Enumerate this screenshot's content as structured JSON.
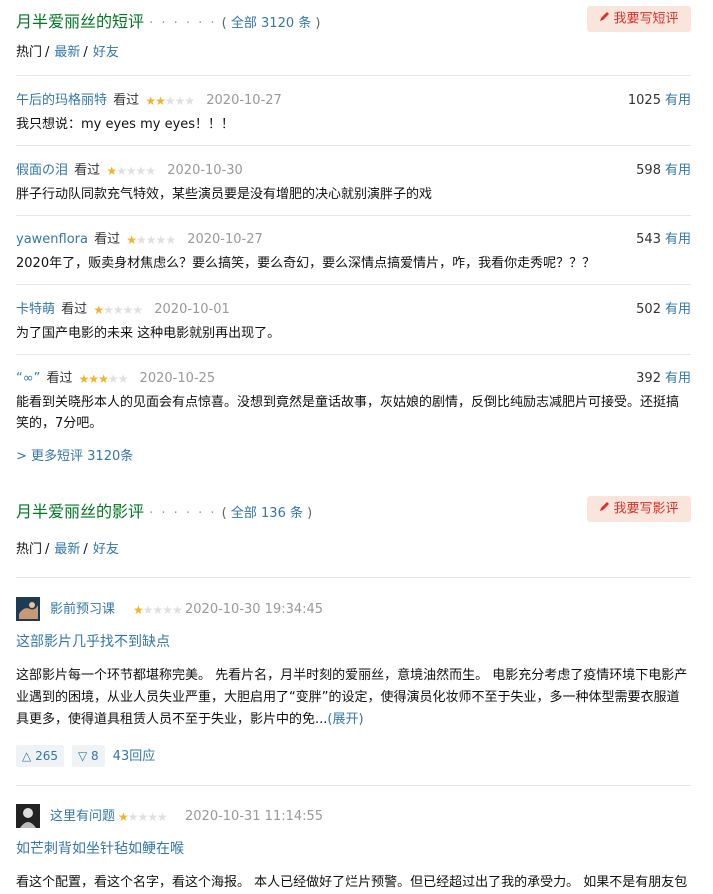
{
  "short_comments": {
    "title": "月半爱丽丝的短评",
    "dots": "· · · · · ·",
    "count_label": "全部 3120 条",
    "write_button": "我要写短评",
    "tabs": [
      "热门",
      "最新",
      "好友"
    ],
    "items": [
      {
        "user": "午后的玛格丽特",
        "status": "看过",
        "rating": 2,
        "date": "2020-10-27",
        "votes": "1025",
        "useful": "有用",
        "text": "我只想说：my eyes my eyes！！！"
      },
      {
        "user": "假面の泪",
        "status": "看过",
        "rating": 1,
        "date": "2020-10-30",
        "votes": "598",
        "useful": "有用",
        "text": "胖子行动队同款充气特效，某些演员要是没有增肥的决心就别演胖子的戏"
      },
      {
        "user": "yawenflora",
        "status": "看过",
        "rating": 1,
        "date": "2020-10-27",
        "votes": "543",
        "useful": "有用",
        "text": "2020年了，贩卖身材焦虑么？要么搞笑，要么奇幻，要么深情点搞爱情片，咋，我看你走秀呢？？？"
      },
      {
        "user": "卡特萌",
        "status": "看过",
        "rating": 1,
        "date": "2020-10-01",
        "votes": "502",
        "useful": "有用",
        "text": "为了国产电影的未来 这种电影就别再出现了。"
      },
      {
        "user": "“∞”",
        "status": "看过",
        "rating": 3,
        "date": "2020-10-25",
        "votes": "392",
        "useful": "有用",
        "text": "能看到关晓彤本人的见面会有点惊喜。没想到竟然是童话故事，灰姑娘的剧情，反倒比纯励志减肥片可接受。还挺搞笑的，7分吧。"
      }
    ],
    "more_link": "> 更多短评 3120条"
  },
  "reviews": {
    "title": "月半爱丽丝的影评",
    "dots": "· · · · · ·",
    "count_label": "全部 136 条",
    "write_button": "我要写影评",
    "tabs": [
      "热门",
      "最新",
      "好友"
    ],
    "items": [
      {
        "user": "影前预习课",
        "rating": 1,
        "date": "2020-10-30 19:34:45",
        "title": "这部影片几乎找不到缺点",
        "body": "这部影片每一个环节都堪称完美。 先看片名，月半时刻的爱丽丝，意境油然而生。 电影充分考虑了疫情环境下电影产业遇到的困境，从业人员失业严重，大胆启用了“变胖”的设定，使得演员化妆师不至于失业，多一种体型需要衣服道具更多，使得道具租赁人员不至于失业，影片中的免...",
        "expand": "(展开)",
        "up": "265",
        "down": "8",
        "replies": "43回应"
      },
      {
        "user": "这里有问题",
        "rating": 1,
        "date": "2020-10-31 11:14:55",
        "title": "如芒刺背如坐针毡如鲠在喉",
        "body": "看这个配置，看这个名字，看这个海报。 本人已经做好了烂片预警。但已经超过出了我的承受力。 如果不是有朋友包"
      }
    ]
  },
  "colors": {
    "link": "#3377aa",
    "section_title": "#007722",
    "write_bg": "#fae5dd",
    "write_fg": "#d8322a",
    "star_on": "#f4b22a",
    "star_off": "#e0e0e0"
  }
}
